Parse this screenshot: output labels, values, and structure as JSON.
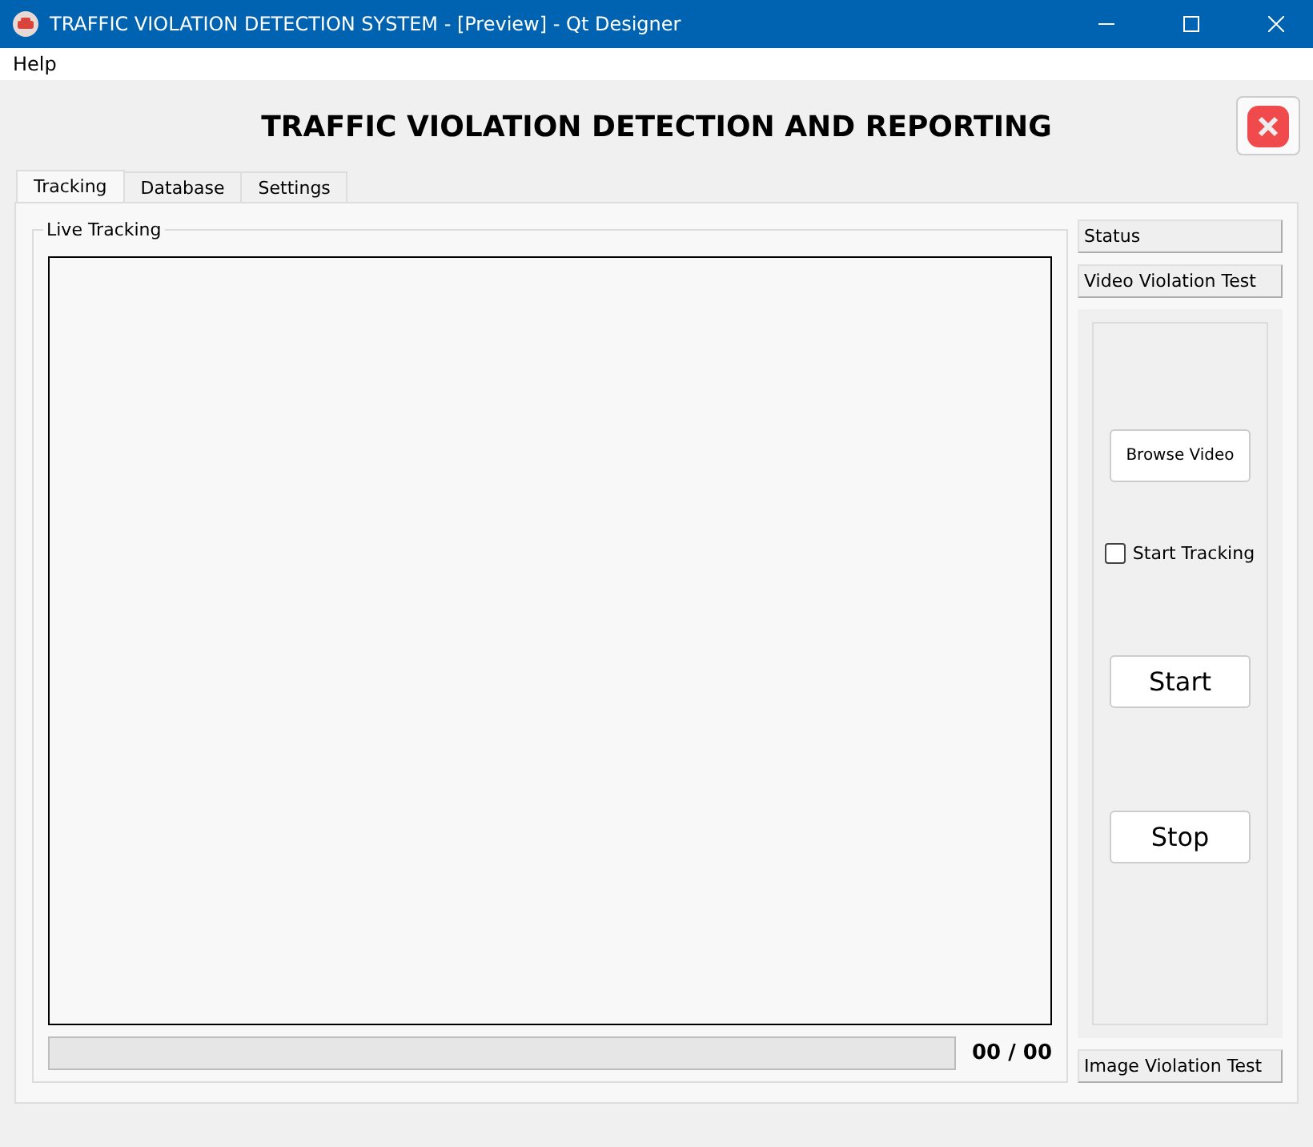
{
  "window": {
    "title": "TRAFFIC VIOLATION DETECTION SYSTEM - [Preview] - Qt Designer"
  },
  "menu": [
    "Help"
  ],
  "heading": "TRAFFIC VIOLATION DETECTION AND REPORTING",
  "tabs": [
    {
      "label": "Tracking",
      "selected": true
    },
    {
      "label": "Database",
      "selected": false
    },
    {
      "label": "Settings",
      "selected": false
    }
  ],
  "live_tracking": {
    "title": "Live Tracking",
    "progress": {
      "level": 0
    },
    "counter": "00 / 00"
  },
  "toolbox": [
    {
      "label": "Status"
    },
    {
      "label": "Video Violation Test",
      "page": {
        "browse_button": "Browse Video",
        "start_tracking": {
          "label": "Start Tracking",
          "checked": false
        },
        "start_button": "Start",
        "stop_button": "Stop"
      }
    },
    {
      "label": "Image Violation Test"
    }
  ]
}
